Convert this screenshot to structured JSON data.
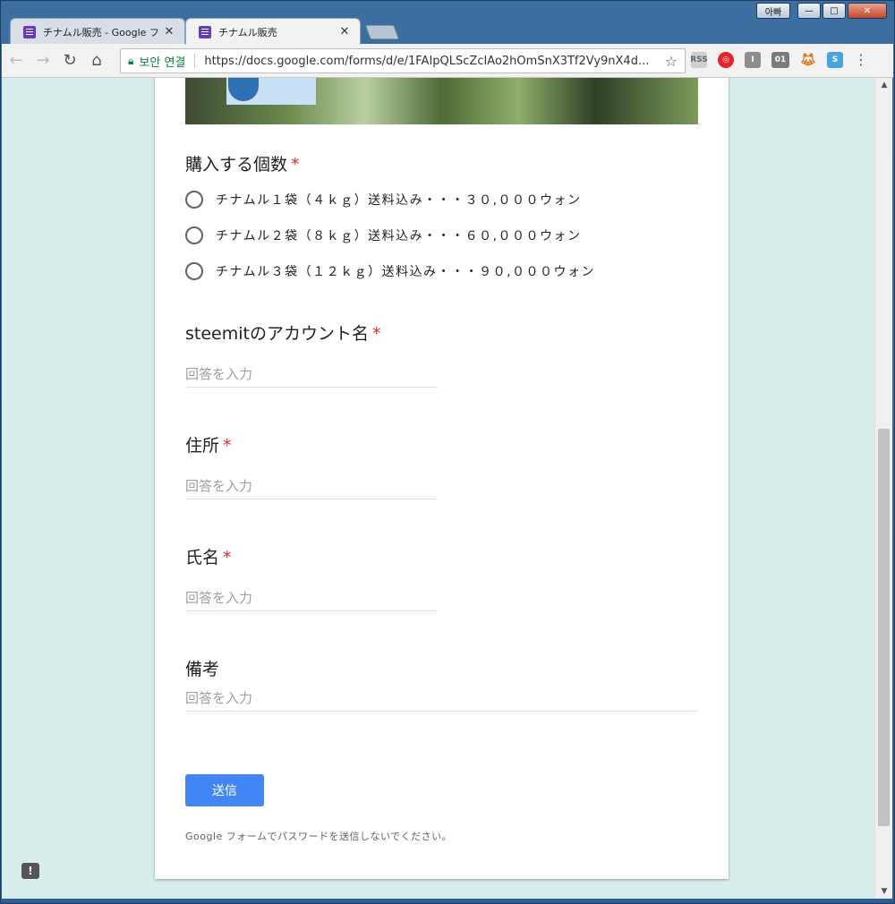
{
  "window": {
    "caption": {
      "user_label": "아빠",
      "minimize": "—",
      "maximize": "□",
      "close": "✕"
    }
  },
  "tabs": [
    {
      "title": "チナムル販売 - Google フ",
      "active": false
    },
    {
      "title": "チナムル販売",
      "active": true
    }
  ],
  "toolbar": {
    "secure_label": "보안 연결",
    "url": "https://docs.google.com/forms/d/e/1FAIpQLScZcIAo2hOmSnX3Tf2Vy9nX4d...",
    "extensions": [
      "rss-icon",
      "adobe-icon",
      "instapaper-icon",
      "binary-icon",
      "metamask-icon",
      "s-icon"
    ]
  },
  "form": {
    "q_quantity": {
      "title": "購入する個数",
      "required": "*"
    },
    "options": [
      "チナムル１袋（４ｋｇ）送料込み・・・３０,０００ウォン",
      "チナムル２袋（８ｋｇ）送料込み・・・６０,０００ウォン",
      "チナムル３袋（１２ｋｇ）送料込み・・・９０,０００ウォン"
    ],
    "q_account": {
      "title": "steemitのアカウント名",
      "required": "*",
      "placeholder": "回答を入力"
    },
    "q_address": {
      "title": "住所",
      "required": "*",
      "placeholder": "回答を入力"
    },
    "q_name": {
      "title": "氏名",
      "required": "*",
      "placeholder": "回答を入力"
    },
    "q_notes": {
      "title": "備考",
      "placeholder": "回答を入力"
    },
    "submit_label": "送信",
    "footer_note": "Google フォームでパスワードを送信しないでください。"
  },
  "colors": {
    "accent": "#4285f4",
    "required": "#d93025",
    "page_bg": "#d8eeec",
    "form_icon": "#673ab7"
  }
}
